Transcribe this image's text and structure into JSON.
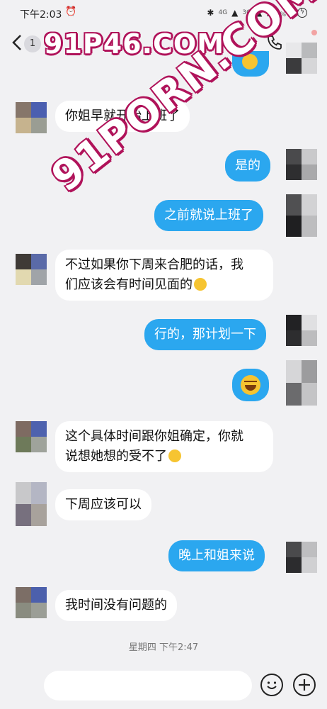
{
  "status_bar": {
    "time": "下午2:03",
    "network_a": "4G",
    "network_b": "3G",
    "battery": "25",
    "battery_unit": "%"
  },
  "header": {
    "unread_count": "1",
    "watermark": "91P46.COM"
  },
  "watermark_overlay": "91PORN.COM",
  "messages": [
    {
      "side": "left",
      "text": "你姐早就开始上班了"
    },
    {
      "side": "right",
      "text": "是的"
    },
    {
      "side": "right",
      "text": "之前就说上班了"
    },
    {
      "side": "left",
      "line1": "不过如果你下周来合肥的话，我",
      "line2": "们应该会有时间见面的"
    },
    {
      "side": "right",
      "text": "行的，那计划一下"
    },
    {
      "side": "right",
      "emoji": "laughing-tears"
    },
    {
      "side": "left",
      "line1": "这个具体时间跟你姐确定，你就",
      "line2": "说想她想的受不了"
    },
    {
      "side": "left",
      "text": "下周应该可以"
    },
    {
      "side": "right",
      "text": "晚上和姐来说"
    },
    {
      "side": "left",
      "text": "我时间没有问题的"
    }
  ],
  "timestamp": "星期四 下午2:47",
  "input": {
    "value": "",
    "placeholder": ""
  },
  "colors": {
    "right_bubble": "#2ba7ef",
    "left_bubble": "#ffffff",
    "background": "#f1f1f3",
    "watermark_outline": "#b0135a"
  }
}
